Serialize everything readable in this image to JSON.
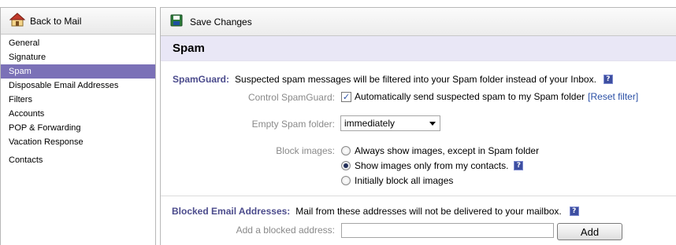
{
  "sidebar": {
    "back_label": "Back to Mail",
    "items": [
      {
        "label": "General"
      },
      {
        "label": "Signature"
      },
      {
        "label": "Spam"
      },
      {
        "label": "Disposable Email Addresses"
      },
      {
        "label": "Filters"
      },
      {
        "label": "Accounts"
      },
      {
        "label": "POP & Forwarding"
      },
      {
        "label": "Vacation Response"
      },
      {
        "label": "Contacts"
      }
    ],
    "active": "Spam"
  },
  "toolbar": {
    "save_label": "Save Changes"
  },
  "page": {
    "title": "Spam"
  },
  "spamguard": {
    "label": "SpamGuard:",
    "description": "Suspected spam messages will be filtered into your Spam folder instead of your Inbox.",
    "help": "?",
    "control_label": "Control SpamGuard:",
    "control_checked": true,
    "control_text": "Automatically send suspected spam to my Spam folder",
    "reset_link": "[Reset filter]",
    "empty_label": "Empty Spam folder:",
    "empty_value": "immediately",
    "block_label": "Block images:",
    "block_options": [
      {
        "label": "Always show images, except in Spam folder",
        "selected": false
      },
      {
        "label": "Show images only from my contacts.",
        "selected": true
      },
      {
        "label": "Initially block all images",
        "selected": false
      }
    ]
  },
  "blocked": {
    "label": "Blocked Email Addresses:",
    "description": "Mail from these addresses will not be delivered to your mailbox.",
    "help": "?",
    "add_label": "Add a blocked address:",
    "input_value": "",
    "add_button": "Add"
  },
  "colors": {
    "accent": "#7b71b7",
    "title_bg": "#e9e7f6",
    "section_label": "#4b4b8c",
    "link": "#2a4fa5"
  }
}
